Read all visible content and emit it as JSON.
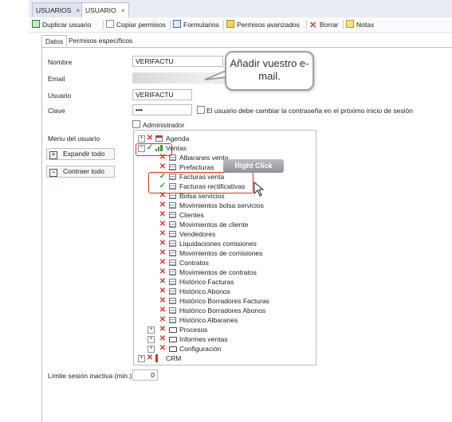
{
  "doc_tabs": [
    {
      "label": "USUARIOS"
    },
    {
      "label": "USUARIO"
    }
  ],
  "toolbar": {
    "duplicate": "Duplicar usuario",
    "copy_perms": "Copiar permisos",
    "forms": "Formularios",
    "advanced": "Permisos avanzados",
    "delete": "Borrar",
    "notes": "Notas"
  },
  "sub_tabs": [
    "Datos",
    "Permisos específicos"
  ],
  "form": {
    "name_label": "Nombre",
    "name_value": "VERIFACTU",
    "email_label": "Email",
    "user_label": "Usuario",
    "user_value": "VERIFACTU",
    "password_label": "Clave",
    "password_value": "•••",
    "change_password_label": "El usuario debe cambiar la contraseña en el próximo inicio de sesión",
    "admin_label": "Administrador",
    "menu_label": "Menu del usuario",
    "expand_all": "Expandir todo",
    "collapse_all": "Contraer todo",
    "idle_limit_label": "Límite sesión inactiva (min.)",
    "idle_limit_value": "0"
  },
  "callout_text": "Añadir vuestro e-mail.",
  "context_label": "Right Click",
  "colors": {
    "deny": "#d9362c",
    "allow": "#2f9e2f",
    "highlight": "#d7332a"
  },
  "tree": [
    {
      "label": "Agenda",
      "level": 0,
      "state": "deny",
      "type": "calendar",
      "expander": "+"
    },
    {
      "label": "Ventas",
      "level": 0,
      "state": "allow",
      "type": "chart",
      "expander": "-"
    },
    {
      "label": "Albaranes venta",
      "level": 1,
      "state": "deny",
      "type": "doc"
    },
    {
      "label": "Prefacturas",
      "level": 1,
      "state": "deny",
      "type": "doc"
    },
    {
      "label": "Facturas venta",
      "level": 1,
      "state": "allow",
      "type": "doc"
    },
    {
      "label": "Facturas rectificativas",
      "level": 1,
      "state": "allow",
      "type": "doc"
    },
    {
      "label": "Bolsa servicios",
      "level": 1,
      "state": "deny",
      "type": "doc"
    },
    {
      "label": "Movimientos bolsa servicios",
      "level": 1,
      "state": "deny",
      "type": "doc"
    },
    {
      "label": "Clientes",
      "level": 1,
      "state": "deny",
      "type": "doc"
    },
    {
      "label": "Movimientos de cliente",
      "level": 1,
      "state": "deny",
      "type": "doc"
    },
    {
      "label": "Vendedores",
      "level": 1,
      "state": "deny",
      "type": "doc"
    },
    {
      "label": "Liquidaciones comisiones",
      "level": 1,
      "state": "deny",
      "type": "doc"
    },
    {
      "label": "Movimientos de comisiones",
      "level": 1,
      "state": "deny",
      "type": "doc"
    },
    {
      "label": "Contratos",
      "level": 1,
      "state": "deny",
      "type": "doc"
    },
    {
      "label": "Movimientos de contratos",
      "level": 1,
      "state": "deny",
      "type": "doc"
    },
    {
      "label": "Histórico Facturas",
      "level": 1,
      "state": "deny",
      "type": "doc"
    },
    {
      "label": "Histórico Abonos",
      "level": 1,
      "state": "deny",
      "type": "doc"
    },
    {
      "label": "Histórico Borradores Facturas",
      "level": 1,
      "state": "deny",
      "type": "doc"
    },
    {
      "label": "Histórico Borradores Abonos",
      "level": 1,
      "state": "deny",
      "type": "doc"
    },
    {
      "label": "Histórico Albaranes",
      "level": 1,
      "state": "deny",
      "type": "doc"
    },
    {
      "label": "Procesos",
      "level": 1,
      "state": "deny",
      "type": "folder",
      "expander": "+"
    },
    {
      "label": "Informes ventas",
      "level": 1,
      "state": "deny",
      "type": "folder",
      "expander": "+"
    },
    {
      "label": "Configuración",
      "level": 1,
      "state": "deny",
      "type": "folder",
      "expander": "+"
    },
    {
      "label": "CRM",
      "level": 0,
      "state": "deny",
      "type": "crm",
      "expander": "+"
    }
  ]
}
